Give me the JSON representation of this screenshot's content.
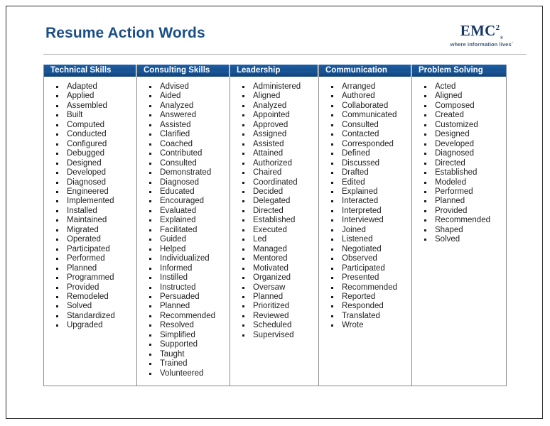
{
  "slide": {
    "title": "Resume Action Words",
    "logo": {
      "name": "EMC",
      "superscript": "2",
      "registered": "®",
      "tagline": "where information lives´"
    }
  },
  "table": {
    "columns": [
      {
        "header": "Technical Skills",
        "words": [
          "Adapted",
          "Applied",
          "Assembled",
          "Built",
          "Computed",
          "Conducted",
          "Configured",
          "Debugged",
          "Designed",
          "Developed",
          "Diagnosed",
          "Engineered",
          "Implemented",
          "Installed",
          "Maintained",
          "Migrated",
          "Operated",
          "Participated",
          "Performed",
          "Planned",
          "Programmed",
          "Provided",
          "Remodeled",
          "Solved",
          "Standardized",
          "Upgraded"
        ]
      },
      {
        "header": "Consulting Skills",
        "words": [
          "Advised",
          "Aided",
          "Analyzed",
          "Answered",
          "Assisted",
          "Clarified",
          "Coached",
          "Contributed",
          "Consulted",
          "Demonstrated",
          "Diagnosed",
          "Educated",
          "Encouraged",
          "Evaluated",
          "Explained",
          "Facilitated",
          "Guided",
          "Helped",
          "Individualized",
          "Informed",
          "Instilled",
          "Instructed",
          "Persuaded",
          "Planned",
          "Recommended",
          "Resolved",
          "Simplified",
          "Supported",
          "Taught",
          "Trained",
          "Volunteered"
        ]
      },
      {
        "header": "Leadership",
        "words": [
          "Administered",
          "Aligned",
          "Analyzed",
          "Appointed",
          "Approved",
          "Assigned",
          "Assisted",
          "Attained",
          "Authorized",
          "Chaired",
          "Coordinated",
          "Decided",
          "Delegated",
          "Directed",
          "Established",
          "Executed",
          "Led",
          "Managed",
          "Mentored",
          "Motivated",
          "Organized",
          "Oversaw",
          "Planned",
          "Prioritized",
          "Reviewed",
          "Scheduled",
          "Supervised"
        ]
      },
      {
        "header": "Communication",
        "words": [
          "Arranged",
          "Authored",
          "Collaborated",
          "Communicated",
          "Consulted",
          "Contacted",
          "Corresponded",
          "Defined",
          "Discussed",
          "Drafted",
          "Edited",
          "Explained",
          "Interacted",
          "Interpreted",
          "Interviewed",
          "Joined",
          "Listened",
          "Negotiated",
          "Observed",
          "Participated",
          "Presented",
          "Recommended",
          "Reported",
          "Responded",
          "Translated",
          "Wrote"
        ]
      },
      {
        "header": "Problem Solving",
        "words": [
          "Acted",
          "Aligned",
          "Composed",
          "Created",
          "Customized",
          "Designed",
          "Developed",
          "Diagnosed",
          "Directed",
          "Established",
          "Modeled",
          "Performed",
          "Planned",
          "Provided",
          "Recommended",
          "Shaped",
          "Solved"
        ]
      }
    ]
  }
}
